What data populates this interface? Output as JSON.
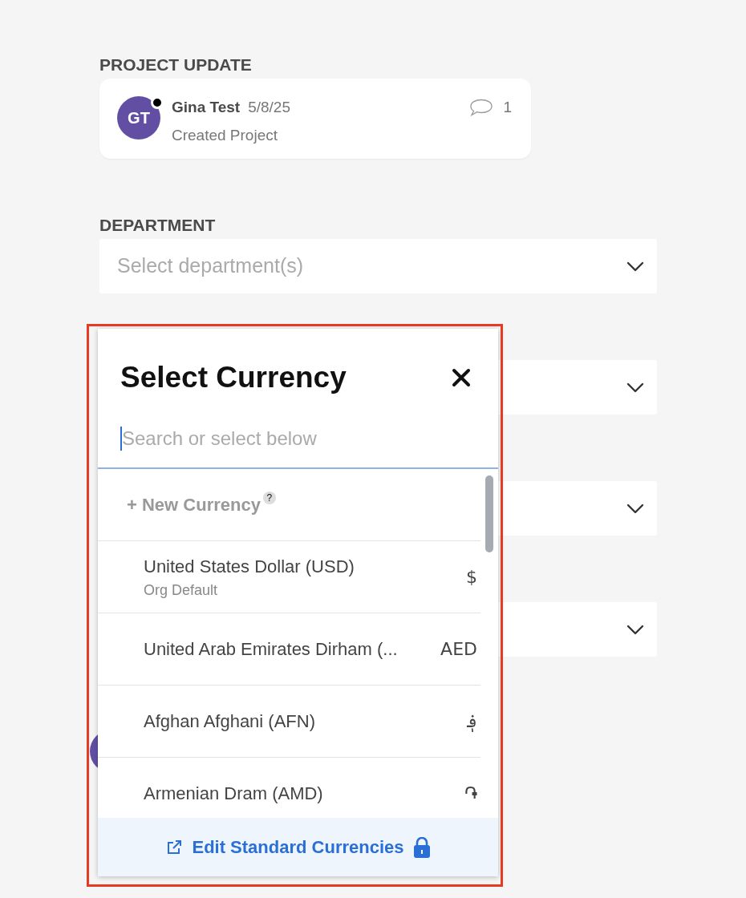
{
  "project_update": {
    "label": "PROJECT UPDATE",
    "initials": "GT",
    "online": true,
    "author": "Gina Test",
    "date": "5/8/25",
    "action": "Created Project",
    "comment_count": "1"
  },
  "department": {
    "label": "DEPARTMENT",
    "placeholder": "Select department(s)",
    "expanded": false
  },
  "more_fields": [
    {
      "expanded": false
    },
    {
      "expanded": false
    },
    {
      "expanded": false
    }
  ],
  "currency_picker": {
    "title": "Select Currency",
    "search": {
      "placeholder": "Search or select below",
      "focused": true
    },
    "new_option": {
      "label": "+ New Currency",
      "help": "?"
    },
    "options": [
      {
        "name": "United States Dollar (USD)",
        "note": "Org Default",
        "symbol": "$"
      },
      {
        "name": "United Arab Emirates Dirham (...",
        "symbol": "AED"
      },
      {
        "name": "Afghan Afghani (AFN)",
        "symbol": "؋"
      },
      {
        "name": "Armenian Dram (AMD)",
        "symbol": "֏"
      }
    ],
    "footer": {
      "label": "Edit Standard Currencies",
      "locked": true
    }
  },
  "highlight": true
}
